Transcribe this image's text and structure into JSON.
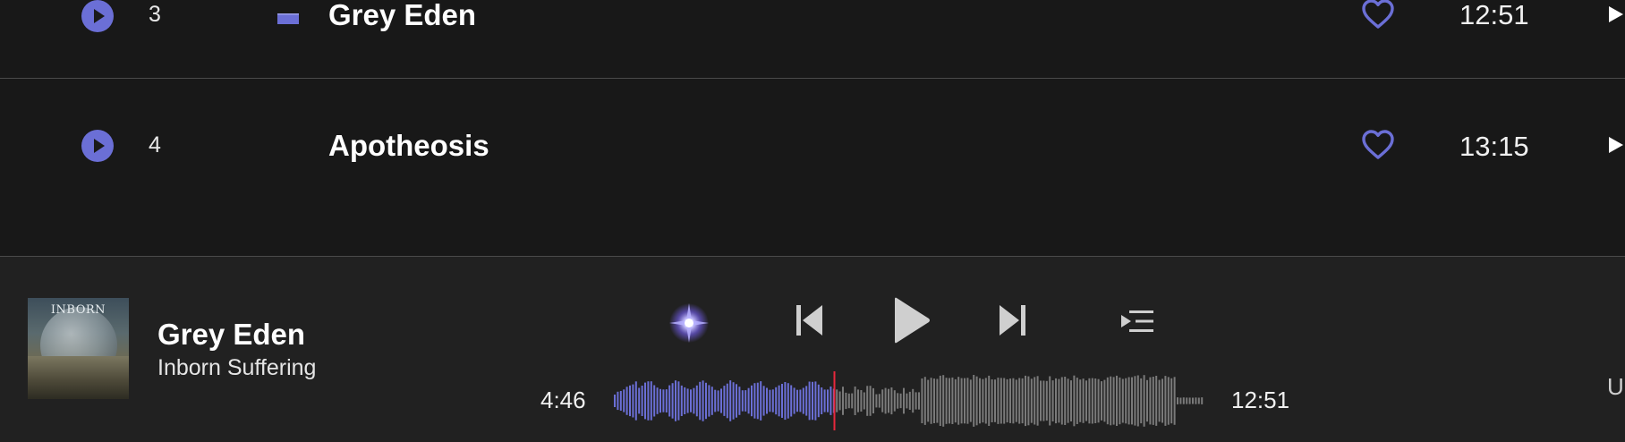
{
  "tracks": [
    {
      "number": "3",
      "title": "Grey Eden",
      "duration": "12:51",
      "playing": true
    },
    {
      "number": "4",
      "title": "Apotheosis",
      "duration": "13:15",
      "playing": false
    }
  ],
  "player": {
    "title": "Grey Eden",
    "artist": "Inborn Suffering",
    "cover_text": "INBORN",
    "current_time": "4:46",
    "total_time": "12:51",
    "progress": 0.372,
    "edge_text": "U"
  },
  "colors": {
    "accent": "#6b6fd6",
    "playhead": "#e8283c",
    "waveform_unplayed": "#7a7a7a",
    "background": "#181818",
    "player_background": "#212121"
  },
  "icons": {
    "row_play": "play-circle-icon",
    "equalizer": "equalizer-icon",
    "favorite": "heart-outline-icon",
    "row_more": "play-arrow-icon",
    "sparkle": "sparkle-icon",
    "previous": "skip-previous-icon",
    "play": "play-icon",
    "next": "skip-next-icon",
    "queue": "queue-icon"
  }
}
